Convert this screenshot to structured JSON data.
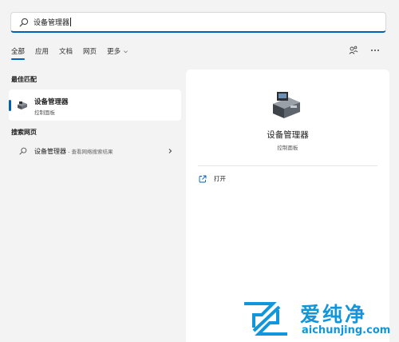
{
  "search": {
    "value": "设备管理器"
  },
  "tabs": [
    {
      "label": "全部",
      "active": true
    },
    {
      "label": "应用"
    },
    {
      "label": "文档"
    },
    {
      "label": "网页"
    },
    {
      "label": "更多"
    }
  ],
  "icons": {
    "share": "share-connect-icon",
    "more": "more-ellipsis-icon",
    "search": "search-icon"
  },
  "best_match": {
    "header": "最佳匹配",
    "title": "设备管理器",
    "subtitle": "控制面板"
  },
  "web_search": {
    "header": "搜索网页",
    "query": "设备管理器",
    "hint": " - 查看网络搜索结果"
  },
  "detail": {
    "title": "设备管理器",
    "subtitle": "控制面板",
    "actions": [
      {
        "label": "打开"
      }
    ]
  },
  "watermark": {
    "chinese": "爱纯净",
    "domain": "aichunjing.com"
  },
  "colors": {
    "accent": "#005fb8",
    "watermark": "#1296db"
  }
}
